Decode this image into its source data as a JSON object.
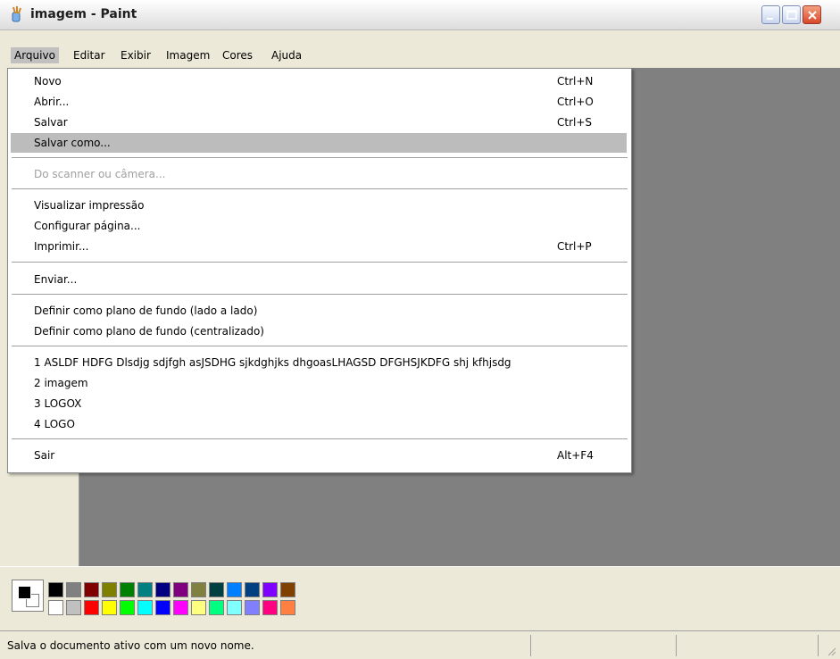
{
  "window": {
    "title": "imagem - Paint"
  },
  "menubar": {
    "items": [
      {
        "label": "Arquivo"
      },
      {
        "label": "Editar"
      },
      {
        "label": "Exibir"
      },
      {
        "label": "Imagem"
      },
      {
        "label": "Cores"
      },
      {
        "label": "Ajuda"
      }
    ]
  },
  "file_menu": {
    "items": [
      {
        "label": "Novo",
        "shortcut": "Ctrl+N"
      },
      {
        "label": "Abrir...",
        "shortcut": "Ctrl+O"
      },
      {
        "label": "Salvar",
        "shortcut": "Ctrl+S"
      },
      {
        "label": "Salvar como...",
        "shortcut": ""
      },
      {
        "label": "Do scanner ou câmera...",
        "shortcut": ""
      },
      {
        "label": "Visualizar impressão",
        "shortcut": ""
      },
      {
        "label": "Configurar página...",
        "shortcut": ""
      },
      {
        "label": "Imprimir...",
        "shortcut": "Ctrl+P"
      },
      {
        "label": "Enviar...",
        "shortcut": ""
      },
      {
        "label": "Definir como plano de fundo (lado a lado)",
        "shortcut": ""
      },
      {
        "label": "Definir como plano de fundo (centralizado)",
        "shortcut": ""
      },
      {
        "label": "1 ASLDF HDFG Dlsdjg sdjfgh asJSDHG sjkdghjks dhgoasLHAGSD DFGHSJKDFG shj kfhjsdg",
        "shortcut": ""
      },
      {
        "label": "2 imagem",
        "shortcut": ""
      },
      {
        "label": "3 LOGOX",
        "shortcut": ""
      },
      {
        "label": "4 LOGO",
        "shortcut": ""
      },
      {
        "label": "Sair",
        "shortcut": "Alt+F4"
      }
    ]
  },
  "palette": {
    "top_row": [
      "#000000",
      "#808080",
      "#800000",
      "#808000",
      "#008000",
      "#008080",
      "#000080",
      "#800080",
      "#808040",
      "#004040",
      "#0080ff",
      "#004080",
      "#8000ff",
      "#804000"
    ],
    "bottom_row": [
      "#ffffff",
      "#c0c0c0",
      "#ff0000",
      "#ffff00",
      "#00ff00",
      "#00ffff",
      "#0000ff",
      "#ff00ff",
      "#ffff80",
      "#00ff80",
      "#80ffff",
      "#8080ff",
      "#ff0080",
      "#ff8040"
    ],
    "foreground": "#000000",
    "background": "#ffffff"
  },
  "status": {
    "text": "Salva o documento ativo com um novo nome."
  },
  "colors": {
    "canvas_bg": "#808080",
    "menu_highlight": "#bcbcbc"
  }
}
